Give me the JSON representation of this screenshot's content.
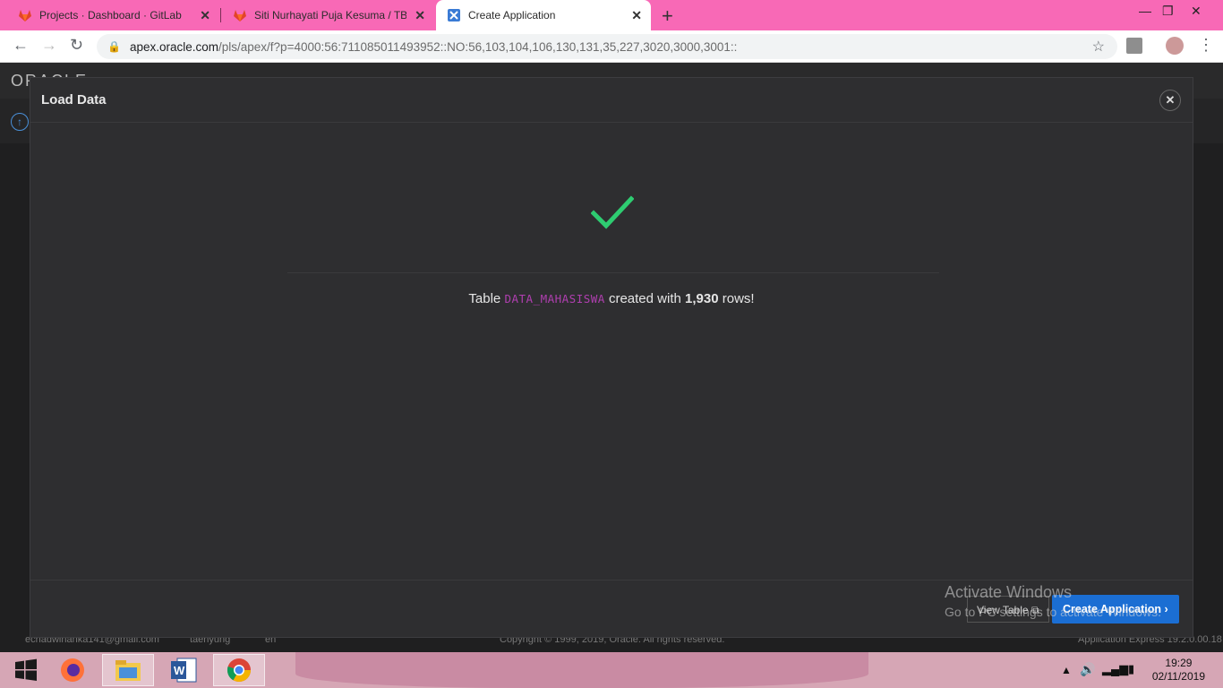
{
  "browser": {
    "tabs": [
      {
        "title": "Projects · Dashboard · GitLab",
        "icon": "gitlab-icon"
      },
      {
        "title": "Siti Nurhayati Puja Kesuma / TB D",
        "icon": "gitlab-icon"
      },
      {
        "title": "Create Application",
        "icon": "apex-icon"
      }
    ],
    "url_host": "apex.oracle.com",
    "url_path": "/pls/apex/f?p=4000:56:711085011493952::NO:56,103,104,106,130,131,35,227,3020,3000,3001::"
  },
  "apex": {
    "logo": "ORACLE",
    "footer_email": "echadwinanka141@gmail.com",
    "footer_workspace": "taehyung",
    "footer_lang": "en",
    "footer_copyright": "Copyright © 1999, 2019, Oracle. All rights reserved.",
    "footer_version": "Application Express 19.2.0.00.18"
  },
  "modal": {
    "title": "Load Data",
    "msg_prefix": "Table ",
    "table_name": "DATA_MAHASISWA",
    "msg_middle": " created with ",
    "row_count": "1,930",
    "msg_suffix": " rows!",
    "view_table_label": "View Table",
    "create_app_label": "Create Application"
  },
  "watermark": {
    "line1": "Activate Windows",
    "line2": "Go to PC settings to activate Windows."
  },
  "taskbar": {
    "time": "19:29",
    "date": "02/11/2019"
  },
  "colors": {
    "tabstrip": "#f869b6",
    "success_check": "#2ecc71",
    "table_name": "#b03fb0",
    "primary_button": "#1b6ed3"
  }
}
